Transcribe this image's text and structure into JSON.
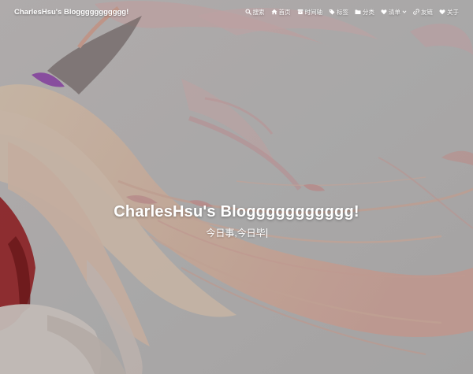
{
  "navbar": {
    "brand": "CharlesHsu's Bloggggggggggg!",
    "items": [
      {
        "label": "搜索",
        "icon": "search-icon"
      },
      {
        "label": "首页",
        "icon": "home-icon"
      },
      {
        "label": "时间轴",
        "icon": "archive-icon"
      },
      {
        "label": "标签",
        "icon": "tag-icon"
      },
      {
        "label": "分类",
        "icon": "folder-icon"
      },
      {
        "label": "清单",
        "icon": "heart-icon",
        "has_dropdown": true
      },
      {
        "label": "友链",
        "icon": "link-icon"
      },
      {
        "label": "关于",
        "icon": "heart-icon"
      }
    ]
  },
  "hero": {
    "title": "CharlesHsu's Bloggggggggggg!",
    "subtitle": "今日事,今日毕"
  },
  "colors": {
    "text": "#ffffff",
    "background": "#c7c7c7",
    "accent_pink": "#e8b7b5",
    "hair": "#f1d9c4",
    "ribbon_purple": "#a45dbf",
    "dress_red": "#a8272b"
  }
}
